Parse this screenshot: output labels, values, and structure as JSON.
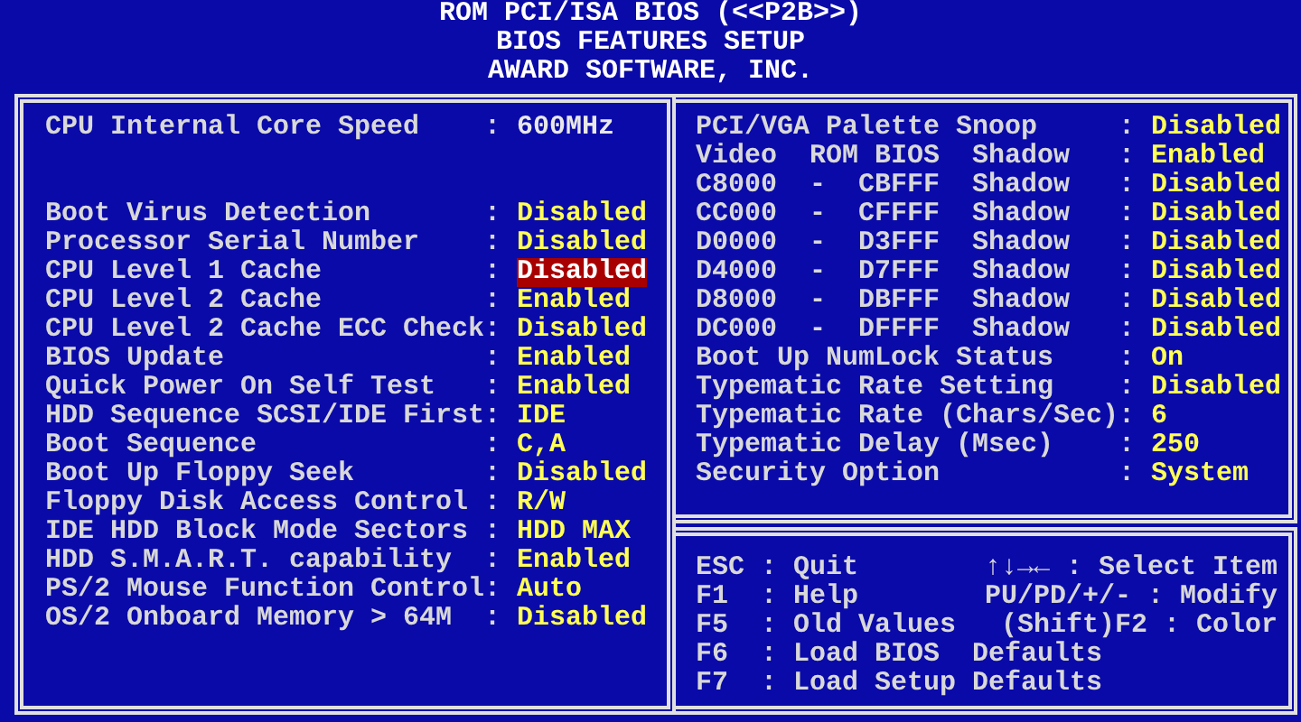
{
  "title_lines": [
    "ROM PCI/ISA BIOS (<<P2B>>)",
    "BIOS FEATURES SETUP",
    "AWARD SOFTWARE, INC."
  ],
  "separator": ":",
  "left_panel": {
    "info": {
      "label": "CPU Internal Core Speed",
      "value": "600MHz"
    },
    "settings": [
      {
        "label": "Boot Virus Detection",
        "value": "Disabled",
        "selected": false
      },
      {
        "label": "Processor Serial Number",
        "value": "Disabled",
        "selected": false
      },
      {
        "label": "CPU Level 1 Cache",
        "value": "Disabled",
        "selected": true
      },
      {
        "label": "CPU Level 2 Cache",
        "value": "Enabled",
        "selected": false
      },
      {
        "label": "CPU Level 2 Cache ECC Check",
        "value": "Disabled",
        "selected": false
      },
      {
        "label": "BIOS Update",
        "value": "Enabled",
        "selected": false
      },
      {
        "label": "Quick Power On Self Test",
        "value": "Enabled",
        "selected": false
      },
      {
        "label": "HDD Sequence SCSI/IDE First",
        "value": "IDE",
        "selected": false
      },
      {
        "label": "Boot Sequence",
        "value": "C,A",
        "selected": false
      },
      {
        "label": "Boot Up Floppy Seek",
        "value": "Disabled",
        "selected": false
      },
      {
        "label": "Floppy Disk Access Control",
        "value": "R/W",
        "selected": false
      },
      {
        "label": "IDE HDD Block Mode Sectors",
        "value": "HDD MAX",
        "selected": false
      },
      {
        "label": "HDD S.M.A.R.T. capability",
        "value": "Enabled",
        "selected": false
      },
      {
        "label": "PS/2 Mouse Function Control",
        "value": "Auto",
        "selected": false
      },
      {
        "label": "OS/2 Onboard Memory > 64M",
        "value": "Disabled",
        "selected": false
      }
    ]
  },
  "right_panel": {
    "settings": [
      {
        "label": "PCI/VGA Palette Snoop",
        "value": "Disabled",
        "selected": false
      },
      {
        "label": "Video  ROM BIOS  Shadow",
        "value": "Enabled",
        "selected": false
      },
      {
        "label": "C8000  -  CBFFF  Shadow",
        "value": "Disabled",
        "selected": false
      },
      {
        "label": "CC000  -  CFFFF  Shadow",
        "value": "Disabled",
        "selected": false
      },
      {
        "label": "D0000  -  D3FFF  Shadow",
        "value": "Disabled",
        "selected": false
      },
      {
        "label": "D4000  -  D7FFF  Shadow",
        "value": "Disabled",
        "selected": false
      },
      {
        "label": "D8000  -  DBFFF  Shadow",
        "value": "Disabled",
        "selected": false
      },
      {
        "label": "DC000  -  DFFFF  Shadow",
        "value": "Disabled",
        "selected": false
      },
      {
        "label": "Boot Up NumLock Status",
        "value": "On",
        "selected": false
      },
      {
        "label": "Typematic Rate Setting",
        "value": "Disabled",
        "selected": false
      },
      {
        "label": "Typematic Rate (Chars/Sec)",
        "value": "6",
        "selected": false
      },
      {
        "label": "Typematic Delay (Msec)",
        "value": "250",
        "selected": false
      },
      {
        "label": "Security Option",
        "value": "System",
        "selected": false
      }
    ]
  },
  "help": [
    {
      "key": "ESC",
      "action": "Quit",
      "hint": "↑↓→← : Select Item"
    },
    {
      "key": "F1",
      "action": "Help",
      "hint": "PU/PD/+/- : Modify"
    },
    {
      "key": "F5",
      "action": "Old Values",
      "hint": "(Shift)F2 : Color"
    },
    {
      "key": "F6",
      "action": "Load BIOS  Defaults"
    },
    {
      "key": "F7",
      "action": "Load Setup Defaults"
    }
  ]
}
